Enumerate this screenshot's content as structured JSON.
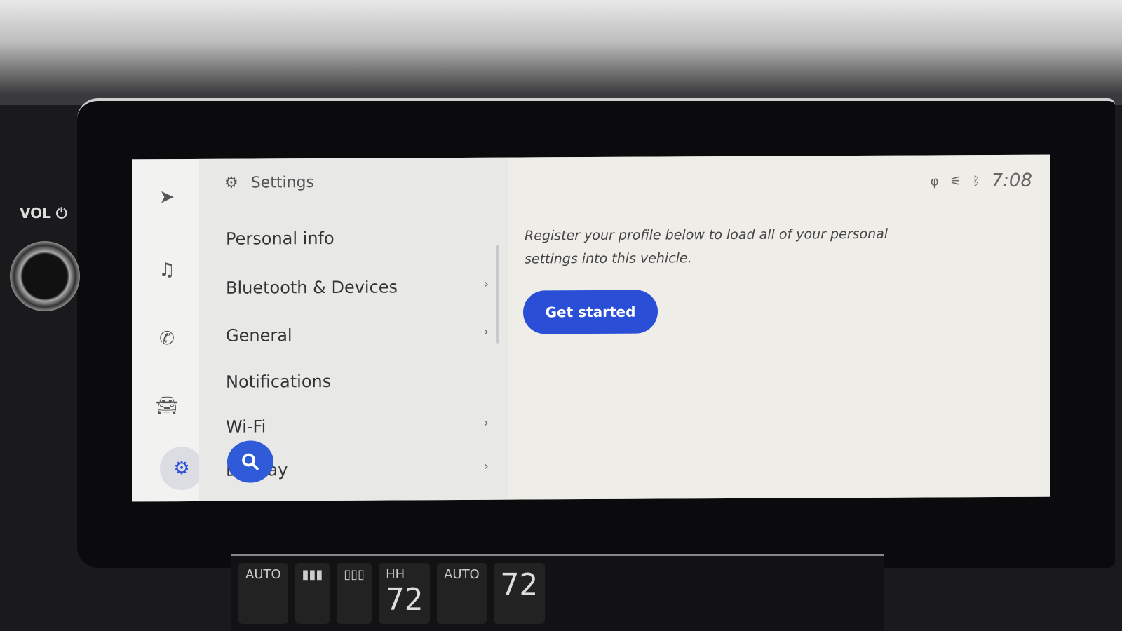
{
  "hardware": {
    "vol_label": "VOL",
    "power_icon": "power-icon"
  },
  "rail": {
    "items": [
      {
        "icon": "navigation-arrow-icon"
      },
      {
        "icon": "music-note-icon"
      },
      {
        "icon": "phone-icon"
      },
      {
        "icon": "car-icon"
      },
      {
        "icon": "gear-icon",
        "selected": true
      }
    ]
  },
  "settings": {
    "title": "Settings",
    "items": [
      {
        "label": "Personal info",
        "chevron": false
      },
      {
        "label": "Bluetooth & Devices",
        "chevron": true
      },
      {
        "label": "General",
        "chevron": true
      },
      {
        "label": "Notifications",
        "chevron": false
      },
      {
        "label": "Wi-Fi",
        "chevron": true
      },
      {
        "label": "Display",
        "chevron": true
      }
    ],
    "chevron": "›"
  },
  "status": {
    "time": "7:08",
    "icons": [
      "wireless-charging-icon",
      "seatbelt-off-icon",
      "bluetooth-icon"
    ]
  },
  "detail": {
    "message": "Register your profile below to load all of your personal settings into this vehicle.",
    "button": "Get started"
  },
  "climate": {
    "auto_left": "AUTO",
    "hh": "HH",
    "temp_left": "72",
    "auto_center": "AUTO",
    "temp_right": "72"
  },
  "colors": {
    "accent": "#2a4fd6",
    "background": "#eeece7"
  }
}
